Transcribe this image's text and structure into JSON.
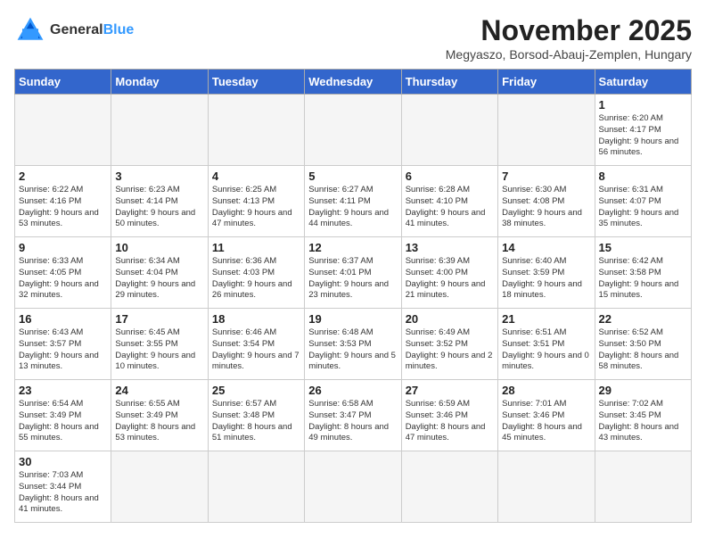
{
  "logo": {
    "line1": "General",
    "line2": "Blue"
  },
  "header": {
    "month": "November 2025",
    "location": "Megyaszo, Borsod-Abauj-Zemplen, Hungary"
  },
  "weekdays": [
    "Sunday",
    "Monday",
    "Tuesday",
    "Wednesday",
    "Thursday",
    "Friday",
    "Saturday"
  ],
  "weeks": [
    [
      {
        "day": "",
        "info": ""
      },
      {
        "day": "",
        "info": ""
      },
      {
        "day": "",
        "info": ""
      },
      {
        "day": "",
        "info": ""
      },
      {
        "day": "",
        "info": ""
      },
      {
        "day": "",
        "info": ""
      },
      {
        "day": "1",
        "info": "Sunrise: 6:20 AM\nSunset: 4:17 PM\nDaylight: 9 hours and 56 minutes."
      }
    ],
    [
      {
        "day": "2",
        "info": "Sunrise: 6:22 AM\nSunset: 4:16 PM\nDaylight: 9 hours and 53 minutes."
      },
      {
        "day": "3",
        "info": "Sunrise: 6:23 AM\nSunset: 4:14 PM\nDaylight: 9 hours and 50 minutes."
      },
      {
        "day": "4",
        "info": "Sunrise: 6:25 AM\nSunset: 4:13 PM\nDaylight: 9 hours and 47 minutes."
      },
      {
        "day": "5",
        "info": "Sunrise: 6:27 AM\nSunset: 4:11 PM\nDaylight: 9 hours and 44 minutes."
      },
      {
        "day": "6",
        "info": "Sunrise: 6:28 AM\nSunset: 4:10 PM\nDaylight: 9 hours and 41 minutes."
      },
      {
        "day": "7",
        "info": "Sunrise: 6:30 AM\nSunset: 4:08 PM\nDaylight: 9 hours and 38 minutes."
      },
      {
        "day": "8",
        "info": "Sunrise: 6:31 AM\nSunset: 4:07 PM\nDaylight: 9 hours and 35 minutes."
      }
    ],
    [
      {
        "day": "9",
        "info": "Sunrise: 6:33 AM\nSunset: 4:05 PM\nDaylight: 9 hours and 32 minutes."
      },
      {
        "day": "10",
        "info": "Sunrise: 6:34 AM\nSunset: 4:04 PM\nDaylight: 9 hours and 29 minutes."
      },
      {
        "day": "11",
        "info": "Sunrise: 6:36 AM\nSunset: 4:03 PM\nDaylight: 9 hours and 26 minutes."
      },
      {
        "day": "12",
        "info": "Sunrise: 6:37 AM\nSunset: 4:01 PM\nDaylight: 9 hours and 23 minutes."
      },
      {
        "day": "13",
        "info": "Sunrise: 6:39 AM\nSunset: 4:00 PM\nDaylight: 9 hours and 21 minutes."
      },
      {
        "day": "14",
        "info": "Sunrise: 6:40 AM\nSunset: 3:59 PM\nDaylight: 9 hours and 18 minutes."
      },
      {
        "day": "15",
        "info": "Sunrise: 6:42 AM\nSunset: 3:58 PM\nDaylight: 9 hours and 15 minutes."
      }
    ],
    [
      {
        "day": "16",
        "info": "Sunrise: 6:43 AM\nSunset: 3:57 PM\nDaylight: 9 hours and 13 minutes."
      },
      {
        "day": "17",
        "info": "Sunrise: 6:45 AM\nSunset: 3:55 PM\nDaylight: 9 hours and 10 minutes."
      },
      {
        "day": "18",
        "info": "Sunrise: 6:46 AM\nSunset: 3:54 PM\nDaylight: 9 hours and 7 minutes."
      },
      {
        "day": "19",
        "info": "Sunrise: 6:48 AM\nSunset: 3:53 PM\nDaylight: 9 hours and 5 minutes."
      },
      {
        "day": "20",
        "info": "Sunrise: 6:49 AM\nSunset: 3:52 PM\nDaylight: 9 hours and 2 minutes."
      },
      {
        "day": "21",
        "info": "Sunrise: 6:51 AM\nSunset: 3:51 PM\nDaylight: 9 hours and 0 minutes."
      },
      {
        "day": "22",
        "info": "Sunrise: 6:52 AM\nSunset: 3:50 PM\nDaylight: 8 hours and 58 minutes."
      }
    ],
    [
      {
        "day": "23",
        "info": "Sunrise: 6:54 AM\nSunset: 3:49 PM\nDaylight: 8 hours and 55 minutes."
      },
      {
        "day": "24",
        "info": "Sunrise: 6:55 AM\nSunset: 3:49 PM\nDaylight: 8 hours and 53 minutes."
      },
      {
        "day": "25",
        "info": "Sunrise: 6:57 AM\nSunset: 3:48 PM\nDaylight: 8 hours and 51 minutes."
      },
      {
        "day": "26",
        "info": "Sunrise: 6:58 AM\nSunset: 3:47 PM\nDaylight: 8 hours and 49 minutes."
      },
      {
        "day": "27",
        "info": "Sunrise: 6:59 AM\nSunset: 3:46 PM\nDaylight: 8 hours and 47 minutes."
      },
      {
        "day": "28",
        "info": "Sunrise: 7:01 AM\nSunset: 3:46 PM\nDaylight: 8 hours and 45 minutes."
      },
      {
        "day": "29",
        "info": "Sunrise: 7:02 AM\nSunset: 3:45 PM\nDaylight: 8 hours and 43 minutes."
      }
    ],
    [
      {
        "day": "30",
        "info": "Sunrise: 7:03 AM\nSunset: 3:44 PM\nDaylight: 8 hours and 41 minutes."
      },
      {
        "day": "",
        "info": ""
      },
      {
        "day": "",
        "info": ""
      },
      {
        "day": "",
        "info": ""
      },
      {
        "day": "",
        "info": ""
      },
      {
        "day": "",
        "info": ""
      },
      {
        "day": "",
        "info": ""
      }
    ]
  ]
}
